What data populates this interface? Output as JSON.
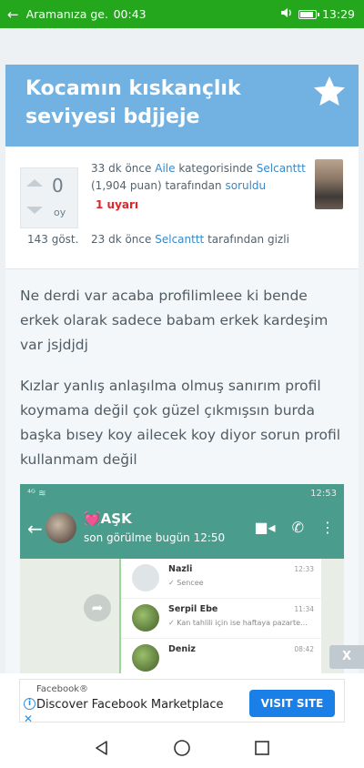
{
  "status_bar": {
    "call_label": "Aramanıza ge...",
    "call_timer": "00:43",
    "time": "13:29"
  },
  "question": {
    "title": "Kocamın kıskançlık seviyesi bdjjeje",
    "votes": "0",
    "votes_unit": "oy",
    "time_ago": "33 dk önce",
    "category": "Aile",
    "category_suffix": "kategorisinde",
    "author": "Selcanttt",
    "points": "(1,904 puan)",
    "by": "tarafından",
    "asked": "soruldu",
    "warning": "1 uyarı",
    "views": "143 göst.",
    "hidden_time_ago": "23 dk önce",
    "hidden_author": "Selcanttt",
    "hidden_suffix": "tarafından gizli",
    "paragraph1": "Ne derdi var acaba profilimleee ki bende erkek olarak sadece babam  erkek kardeşim var jsjdjdj",
    "paragraph2": "Kızlar yanlış anlaşılma olmuş sanırım profil koymama değil çok güzel çıkmışsın burda başka bısey koy ailecek koy diyor sorun profil kullanmam değil"
  },
  "embedded_screenshot": {
    "status_time": "12:53",
    "chat_name": "💓AŞK",
    "last_seen": "son görülme bugün 12:50",
    "contacts": [
      {
        "name": "Nazli",
        "sub": "✓ Sencee",
        "time": "12:33"
      },
      {
        "name": "Serpil Ebe",
        "sub": "✓ Kan tahlili için ise haftaya pazarte...",
        "time": "11:34"
      },
      {
        "name": "Deniz",
        "sub": "",
        "time": "08:42"
      }
    ]
  },
  "close_label": "X",
  "ad": {
    "source": "Facebook®",
    "title": "Discover Facebook Marketplace",
    "button": "VISIT SITE",
    "info_icon": "info-icon",
    "close_icon": "close-icon"
  },
  "colors": {
    "status_green": "#24a61d",
    "title_blue": "#72b2e3",
    "link_blue": "#3589c8",
    "warning_red": "#e0252a",
    "whatsapp_teal": "#4a9c8d",
    "ad_button": "#1b7fe8"
  }
}
